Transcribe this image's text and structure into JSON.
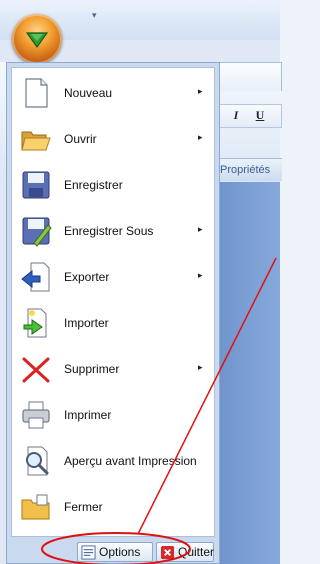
{
  "background": {
    "panel_header": "Propriétés",
    "format_buttons": {
      "italic": "I",
      "underline": "U"
    },
    "quick_access_arrow": "▾"
  },
  "menu": {
    "items": [
      {
        "label": "Nouveau",
        "icon": "new-document-icon",
        "has_submenu": true
      },
      {
        "label": "Ouvrir",
        "icon": "open-folder-icon",
        "has_submenu": true
      },
      {
        "label": "Enregistrer",
        "icon": "save-floppy-icon",
        "has_submenu": false
      },
      {
        "label": "Enregistrer Sous",
        "icon": "save-as-icon",
        "has_submenu": true
      },
      {
        "label": "Exporter",
        "icon": "export-icon",
        "has_submenu": true
      },
      {
        "label": "Importer",
        "icon": "import-icon",
        "has_submenu": false
      },
      {
        "label": "Supprimer",
        "icon": "delete-x-icon",
        "has_submenu": true
      },
      {
        "label": "Imprimer",
        "icon": "printer-icon",
        "has_submenu": false
      },
      {
        "label": "Aperçu avant Impression",
        "icon": "print-preview-icon",
        "has_submenu": false
      },
      {
        "label": "Fermer",
        "icon": "close-folder-icon",
        "has_submenu": false
      }
    ],
    "submenu_arrow": "▸",
    "footer": {
      "options_label": "Options",
      "quit_label": "Quitter"
    }
  },
  "colors": {
    "orb": "#f3a132",
    "orb_arrow": "#2f9a2f",
    "annotation": "#e01010",
    "workspace": "#7fa2d6"
  }
}
